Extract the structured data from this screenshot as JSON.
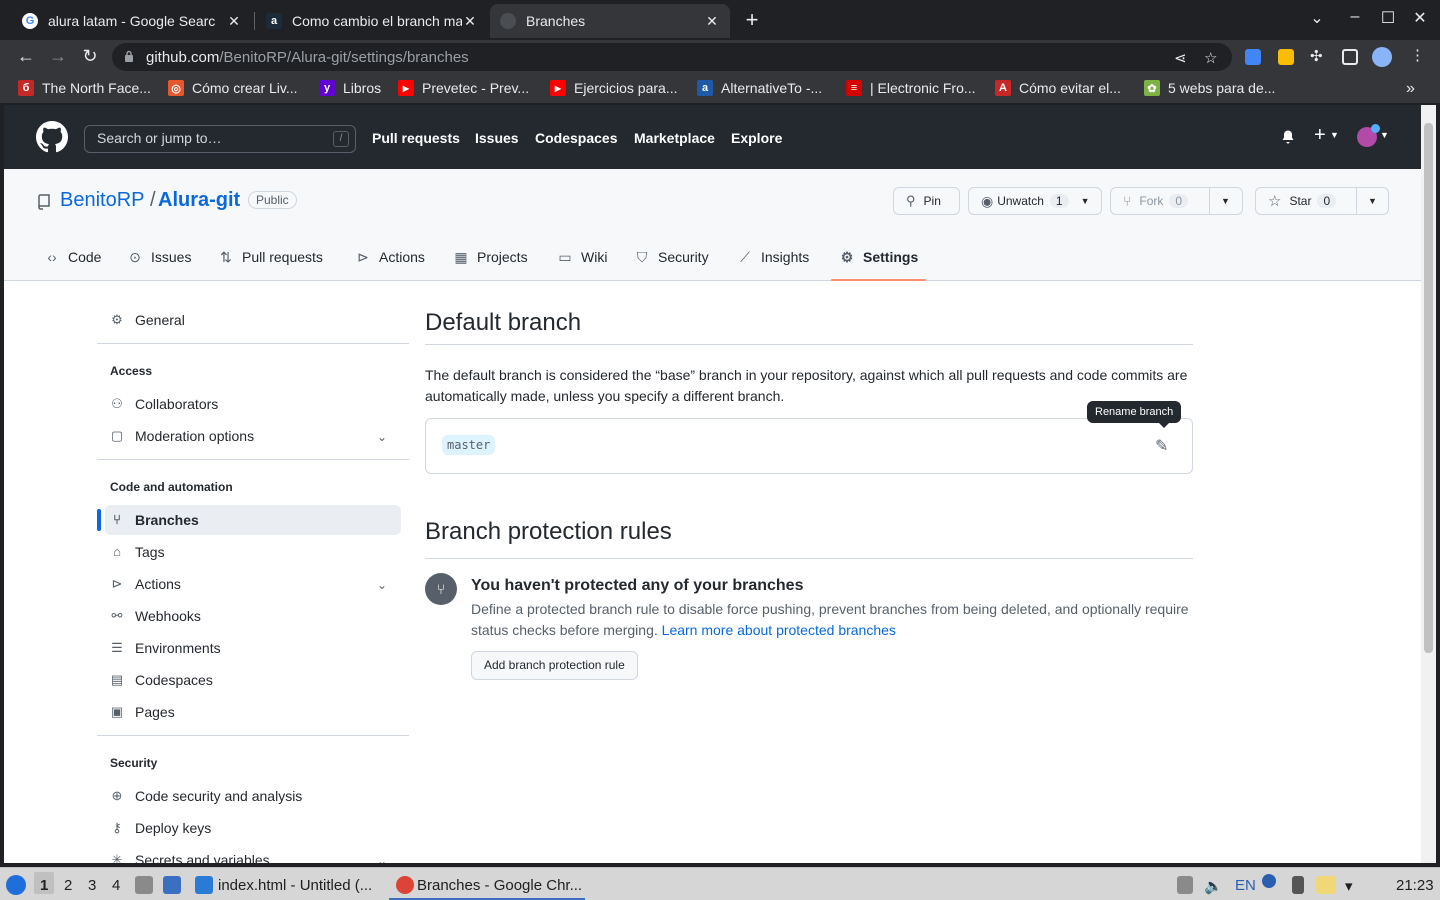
{
  "browser": {
    "tabs": [
      {
        "title": "alura latam - Google Searc",
        "favicon": "google-icon"
      },
      {
        "title": "Como cambio el branch ma",
        "favicon": "alura-icon"
      },
      {
        "title": "Branches",
        "favicon": "github-icon"
      }
    ],
    "url_host": "github.com",
    "url_path": "/BenitoRP/Alura-git/settings/branches",
    "bookmarks": [
      {
        "label": "The North Face...",
        "color": "#c62828",
        "glyph": "б"
      },
      {
        "label": "Cómo crear Liv...",
        "color": "#e8572c",
        "glyph": "◎"
      },
      {
        "label": "Libros",
        "color": "#6001d2",
        "glyph": "y"
      },
      {
        "label": "Prevetec - Prev...",
        "color": "#ff0000",
        "glyph": "▶"
      },
      {
        "label": "Ejercicios para...",
        "color": "#ff0000",
        "glyph": "▶"
      },
      {
        "label": "AlternativeTo -...",
        "color": "#1e5aa8",
        "glyph": "a"
      },
      {
        "label": "| Electronic Fro...",
        "color": "#d50000",
        "glyph": "≡"
      },
      {
        "label": "Cómo evitar el...",
        "color": "#c62828",
        "glyph": "A"
      },
      {
        "label": "5 webs para de...",
        "color": "#7cb342",
        "glyph": "✿"
      }
    ]
  },
  "github": {
    "search_placeholder": "Search or jump to…",
    "search_shortcut": "/",
    "nav": [
      "Pull requests",
      "Issues",
      "Codespaces",
      "Marketplace",
      "Explore"
    ],
    "owner": "BenitoRP",
    "separator": "/",
    "repo": "Alura-git",
    "visibility": "Public",
    "pin_label": "Pin",
    "watch_label": "Unwatch",
    "watch_count": "1",
    "fork_label": "Fork",
    "fork_count": "0",
    "star_label": "Star",
    "star_count": "0",
    "repo_tabs": [
      "Code",
      "Issues",
      "Pull requests",
      "Actions",
      "Projects",
      "Wiki",
      "Security",
      "Insights",
      "Settings"
    ],
    "selected_tab": "Settings"
  },
  "sidebar": {
    "general": "General",
    "access_heading": "Access",
    "collaborators": "Collaborators",
    "moderation": "Moderation options",
    "code_heading": "Code and automation",
    "branches": "Branches",
    "tags": "Tags",
    "actions": "Actions",
    "webhooks": "Webhooks",
    "environments": "Environments",
    "codespaces": "Codespaces",
    "pages": "Pages",
    "security_heading": "Security",
    "code_security": "Code security and analysis",
    "deploy_keys": "Deploy keys",
    "secrets": "Secrets and variables"
  },
  "main": {
    "default_branch_title": "Default branch",
    "default_branch_desc": "The default branch is considered the “base” branch in your repository, against which all pull requests and code commits are automatically made, unless you specify a different branch.",
    "branch_name": "master",
    "rename_tooltip": "Rename branch",
    "protection_title": "Branch protection rules",
    "blank_title": "You haven't protected any of your branches",
    "blank_desc": "Define a protected branch rule to disable force pushing, prevent branches from being deleted, and optionally require status checks before merging.",
    "learn_more": "Learn more about protected branches",
    "add_rule_button": "Add branch protection rule"
  },
  "taskbar": {
    "workspaces": [
      "1",
      "2",
      "3",
      "4"
    ],
    "apps": [
      {
        "title": "index.html - Untitled (...",
        "icon": "vscode-icon"
      },
      {
        "title": "Branches - Google Chr...",
        "icon": "chrome-icon"
      }
    ],
    "language": "EN",
    "clock": "21:23"
  }
}
